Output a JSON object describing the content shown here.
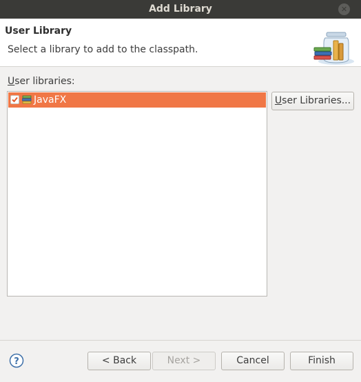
{
  "window": {
    "title": "Add Library",
    "close_glyph": "✕"
  },
  "header": {
    "title": "User Library",
    "description": "Select a library to add to the classpath.",
    "icon": "library-jar-icon"
  },
  "libraries": {
    "label_mnemonic": "U",
    "label_rest": "ser libraries:",
    "items": [
      {
        "label": "JavaFX",
        "checked": true,
        "selected": true,
        "icon": "library-icon"
      }
    ]
  },
  "buttons": {
    "user_libraries_mnemonic": "U",
    "user_libraries_rest": "ser Libraries...",
    "back": "< Back",
    "next": "Next >",
    "cancel": "Cancel",
    "finish": "Finish"
  },
  "help": {
    "icon": "help-icon"
  },
  "colors": {
    "selection": "#f07746",
    "titlebar": "#3a3a37"
  }
}
